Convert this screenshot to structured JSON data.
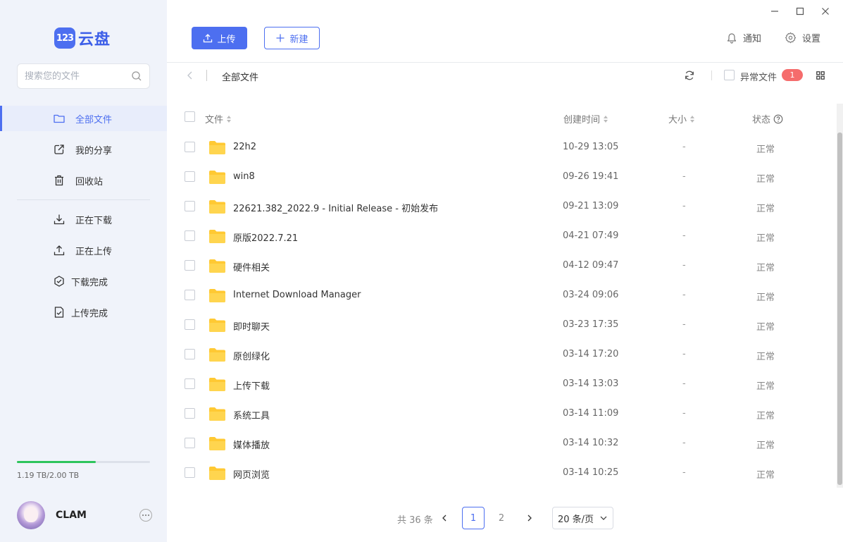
{
  "app": {
    "logo_badge": "123",
    "logo_text": "云盘"
  },
  "sidebar": {
    "search_placeholder": "搜索您的文件",
    "items": [
      {
        "label": "全部文件",
        "icon": "folder-icon",
        "active": true
      },
      {
        "label": "我的分享",
        "icon": "share-icon",
        "active": false
      },
      {
        "label": "回收站",
        "icon": "trash-icon",
        "active": false
      },
      {
        "label": "正在下载",
        "icon": "download-icon",
        "active": false
      },
      {
        "label": "正在上传",
        "icon": "upload-icon",
        "active": false
      },
      {
        "label": "下载完成",
        "icon": "check-circle-icon",
        "active": false
      },
      {
        "label": "上传完成",
        "icon": "file-check-icon",
        "active": false
      }
    ],
    "storage_text": "1.19 TB/2.00 TB",
    "storage_fraction": 0.595,
    "username": "CLAM"
  },
  "toolbar": {
    "upload_label": "上传",
    "new_label": "新建",
    "notify_label": "通知",
    "settings_label": "设置"
  },
  "breadcrumb": {
    "title": "全部文件",
    "abnormal_label": "异常文件",
    "abnormal_count": "1"
  },
  "table": {
    "headers": {
      "name": "文件",
      "created": "创建时间",
      "size": "大小",
      "status": "状态"
    },
    "rows": [
      {
        "name": "22h2",
        "time": "10-29 13:05",
        "size": "-",
        "status": "正常"
      },
      {
        "name": "win8",
        "time": "09-26 19:41",
        "size": "-",
        "status": "正常"
      },
      {
        "name": "22621.382_2022.9 - Initial Release - 初始发布",
        "time": "09-21 13:09",
        "size": "-",
        "status": "正常"
      },
      {
        "name": "原版2022.7.21",
        "time": "04-21 07:49",
        "size": "-",
        "status": "正常"
      },
      {
        "name": "硬件相关",
        "time": "04-12 09:47",
        "size": "-",
        "status": "正常"
      },
      {
        "name": "Internet Download Manager",
        "time": "03-24 09:06",
        "size": "-",
        "status": "正常"
      },
      {
        "name": "即时聊天",
        "time": "03-23 17:35",
        "size": "-",
        "status": "正常"
      },
      {
        "name": "原创绿化",
        "time": "03-14 17:20",
        "size": "-",
        "status": "正常"
      },
      {
        "name": "上传下载",
        "time": "03-14 13:03",
        "size": "-",
        "status": "正常"
      },
      {
        "name": "系统工具",
        "time": "03-14 11:09",
        "size": "-",
        "status": "正常"
      },
      {
        "name": "媒体播放",
        "time": "03-14 10:32",
        "size": "-",
        "status": "正常"
      },
      {
        "name": "网页浏览",
        "time": "03-14 10:25",
        "size": "-",
        "status": "正常"
      }
    ]
  },
  "pagination": {
    "total": "共 36 条",
    "pages": [
      "1",
      "2"
    ],
    "current": "1",
    "page_size": "20 条/页"
  },
  "colors": {
    "accent": "#4d6ff0",
    "storage": "#2ec55c",
    "badge": "#f56c6c",
    "folder": "#ffc933"
  }
}
